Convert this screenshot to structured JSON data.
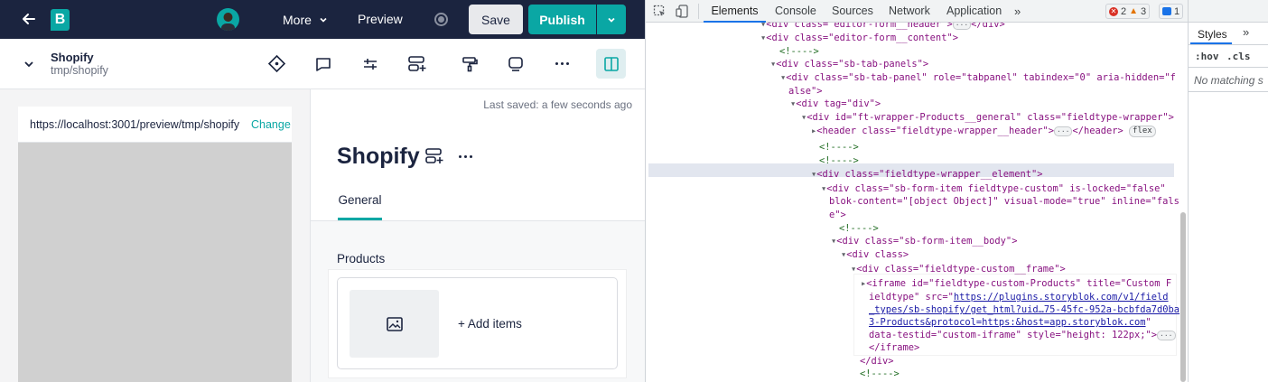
{
  "topbar": {
    "more_label": "More",
    "preview_label": "Preview",
    "save_label": "Save",
    "publish_label": "Publish",
    "logo_letter": "B"
  },
  "subbar": {
    "space_title": "Shopify",
    "space_path": "tmp/shopify"
  },
  "preview": {
    "url": "https://localhost:3001/preview/tmp/shopify",
    "change_label": "Change u"
  },
  "editor": {
    "last_saved": "Last saved: a few seconds ago",
    "title": "Shopify",
    "tabs": [
      {
        "label": "General"
      }
    ],
    "field_label": "Products",
    "add_items_label": "+ Add items"
  },
  "devtools": {
    "tabs": [
      {
        "label": "Elements"
      },
      {
        "label": "Console"
      },
      {
        "label": "Sources"
      },
      {
        "label": "Network"
      },
      {
        "label": "Application"
      }
    ],
    "errors": "2",
    "warnings": "3",
    "messages": "1",
    "styles_tab": "Styles",
    "hov": ":hov",
    "cls": ".cls",
    "no_matching": "No matching s"
  },
  "dom_lines": [
    "<div class=\"editor-form__header\">…</div>",
    "<div class=\"editor-form__content\">",
    "<!---->",
    "<div class=\"sb-tab-panels\">",
    "<div class=\"sb-tab-panel\" role=\"tabpanel\" tabindex=\"0\" aria-hidden=\"false\">",
    "<div tag=\"div\">",
    "<div id=\"ft-wrapper-Products__general\" class=\"fieldtype-wrapper\">",
    "<header class=\"fieldtype-wrapper__header\">…</header>",
    "flex",
    "<!---->",
    "<!---->",
    "<div class=\"fieldtype-wrapper__element\">",
    "<div class=\"sb-form-item fieldtype-custom\" is-locked=\"false\" blok-content=\"[object Object]\" visual-mode=\"true\" inline=\"false\">",
    "<!---->",
    "<div class=\"sb-form-item__body\">",
    "<div class>",
    "<div class=\"fieldtype-custom__frame\">",
    "<iframe id=\"fieldtype-custom-Products\" title=\"Custom Fieldtype\" src=\"https://plugins.storyblok.com/v1/field_types/sb-shopify/get_html?uid…75-45fc-952a-bcbfda7d0ba3-Products&protocol=https:&host=app.storyblok.com\" data-testid=\"custom-iframe\" style=\"height: 122px;\">…</iframe>",
    "</div>",
    "<!---->"
  ],
  "dom_text": {
    "l0a": "<div class= editor-form__header >",
    "l0b": "</div>",
    "l1": "<div class=\"editor-form__content\">",
    "c2": "<!---->",
    "l3": "<div class=\"sb-tab-panels\">",
    "l4a": "<div class=\"sb-tab-panel\" role=\"tabpanel\" tabindex=\"0\" aria-hidden=\"f",
    "l4b": "alse\">",
    "l5": "<div tag=\"div\">",
    "l6": "<div id=\"ft-wrapper-Products__general\" class=\"fieldtype-wrapper\">",
    "l7a": "<header class=\"fieldtype-wrapper__header\">",
    "l7b": "</header>",
    "l7badge": "flex",
    "c8": "<!---->",
    "c9": "<!---->",
    "l10": "<div class=\"fieldtype-wrapper__element\">",
    "l11a": "<div class=\"sb-form-item fieldtype-custom\" is-locked=\"false\"",
    "l11b": "blok-content=\"[object Object]\" visual-mode=\"true\" inline=\"fals",
    "l11c": "e\">",
    "c12": "<!---->",
    "l13": "<div class=\"sb-form-item__body\">",
    "l14": "<div class>",
    "l15": "<div class=\"fieldtype-custom__frame\">",
    "l16a": "<iframe id=\"fieldtype-custom-Products\" title=\"Custom F",
    "l16b": "ieldtype\" src=\"",
    "l16link1": "https://plugins.storyblok.com/v1/field",
    "l16link2": "_types/sb-shopify/get_html?uid…75-45fc-952a-bcbfda7d0ba",
    "l16link3": "3-Products&protocol=https:&host=app.storyblok.com",
    "l16c": "\"",
    "l16d": "data-testid=\"custom-iframe\" style=\"height: 122px;\">",
    "l16e": "</iframe>",
    "l17": "</div>",
    "c18": "<!---->"
  },
  "colors": {
    "topbar_bg": "#1b243f",
    "publish": "#0aa7a4",
    "accent_tab": "#0aa7a4",
    "devtools_blue": "#1a73e8"
  }
}
